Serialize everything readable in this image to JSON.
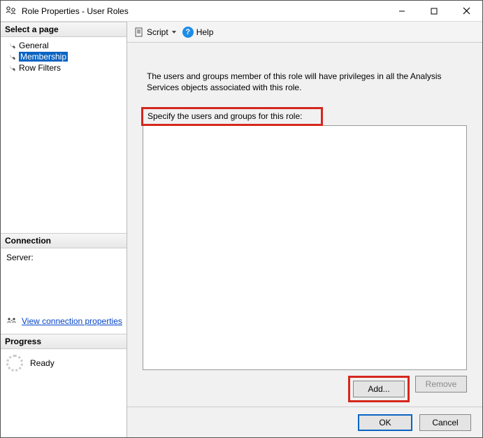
{
  "window": {
    "title": "Role Properties - User Roles"
  },
  "sidebar": {
    "select_page_header": "Select a page",
    "pages": [
      {
        "label": "General"
      },
      {
        "label": "Membership"
      },
      {
        "label": "Row Filters"
      }
    ],
    "connection_header": "Connection",
    "server_label": "Server:",
    "view_connection_link": "View connection properties",
    "progress_header": "Progress",
    "progress_status": "Ready"
  },
  "toolbar": {
    "script_label": "Script",
    "help_label": "Help"
  },
  "main": {
    "intro_text": "The users and groups member of this role will have privileges in all the Analysis Services objects associated with this role.",
    "specify_label": "Specify the users and groups for this role:",
    "add_label": "Add...",
    "remove_label": "Remove"
  },
  "footer": {
    "ok_label": "OK",
    "cancel_label": "Cancel"
  }
}
